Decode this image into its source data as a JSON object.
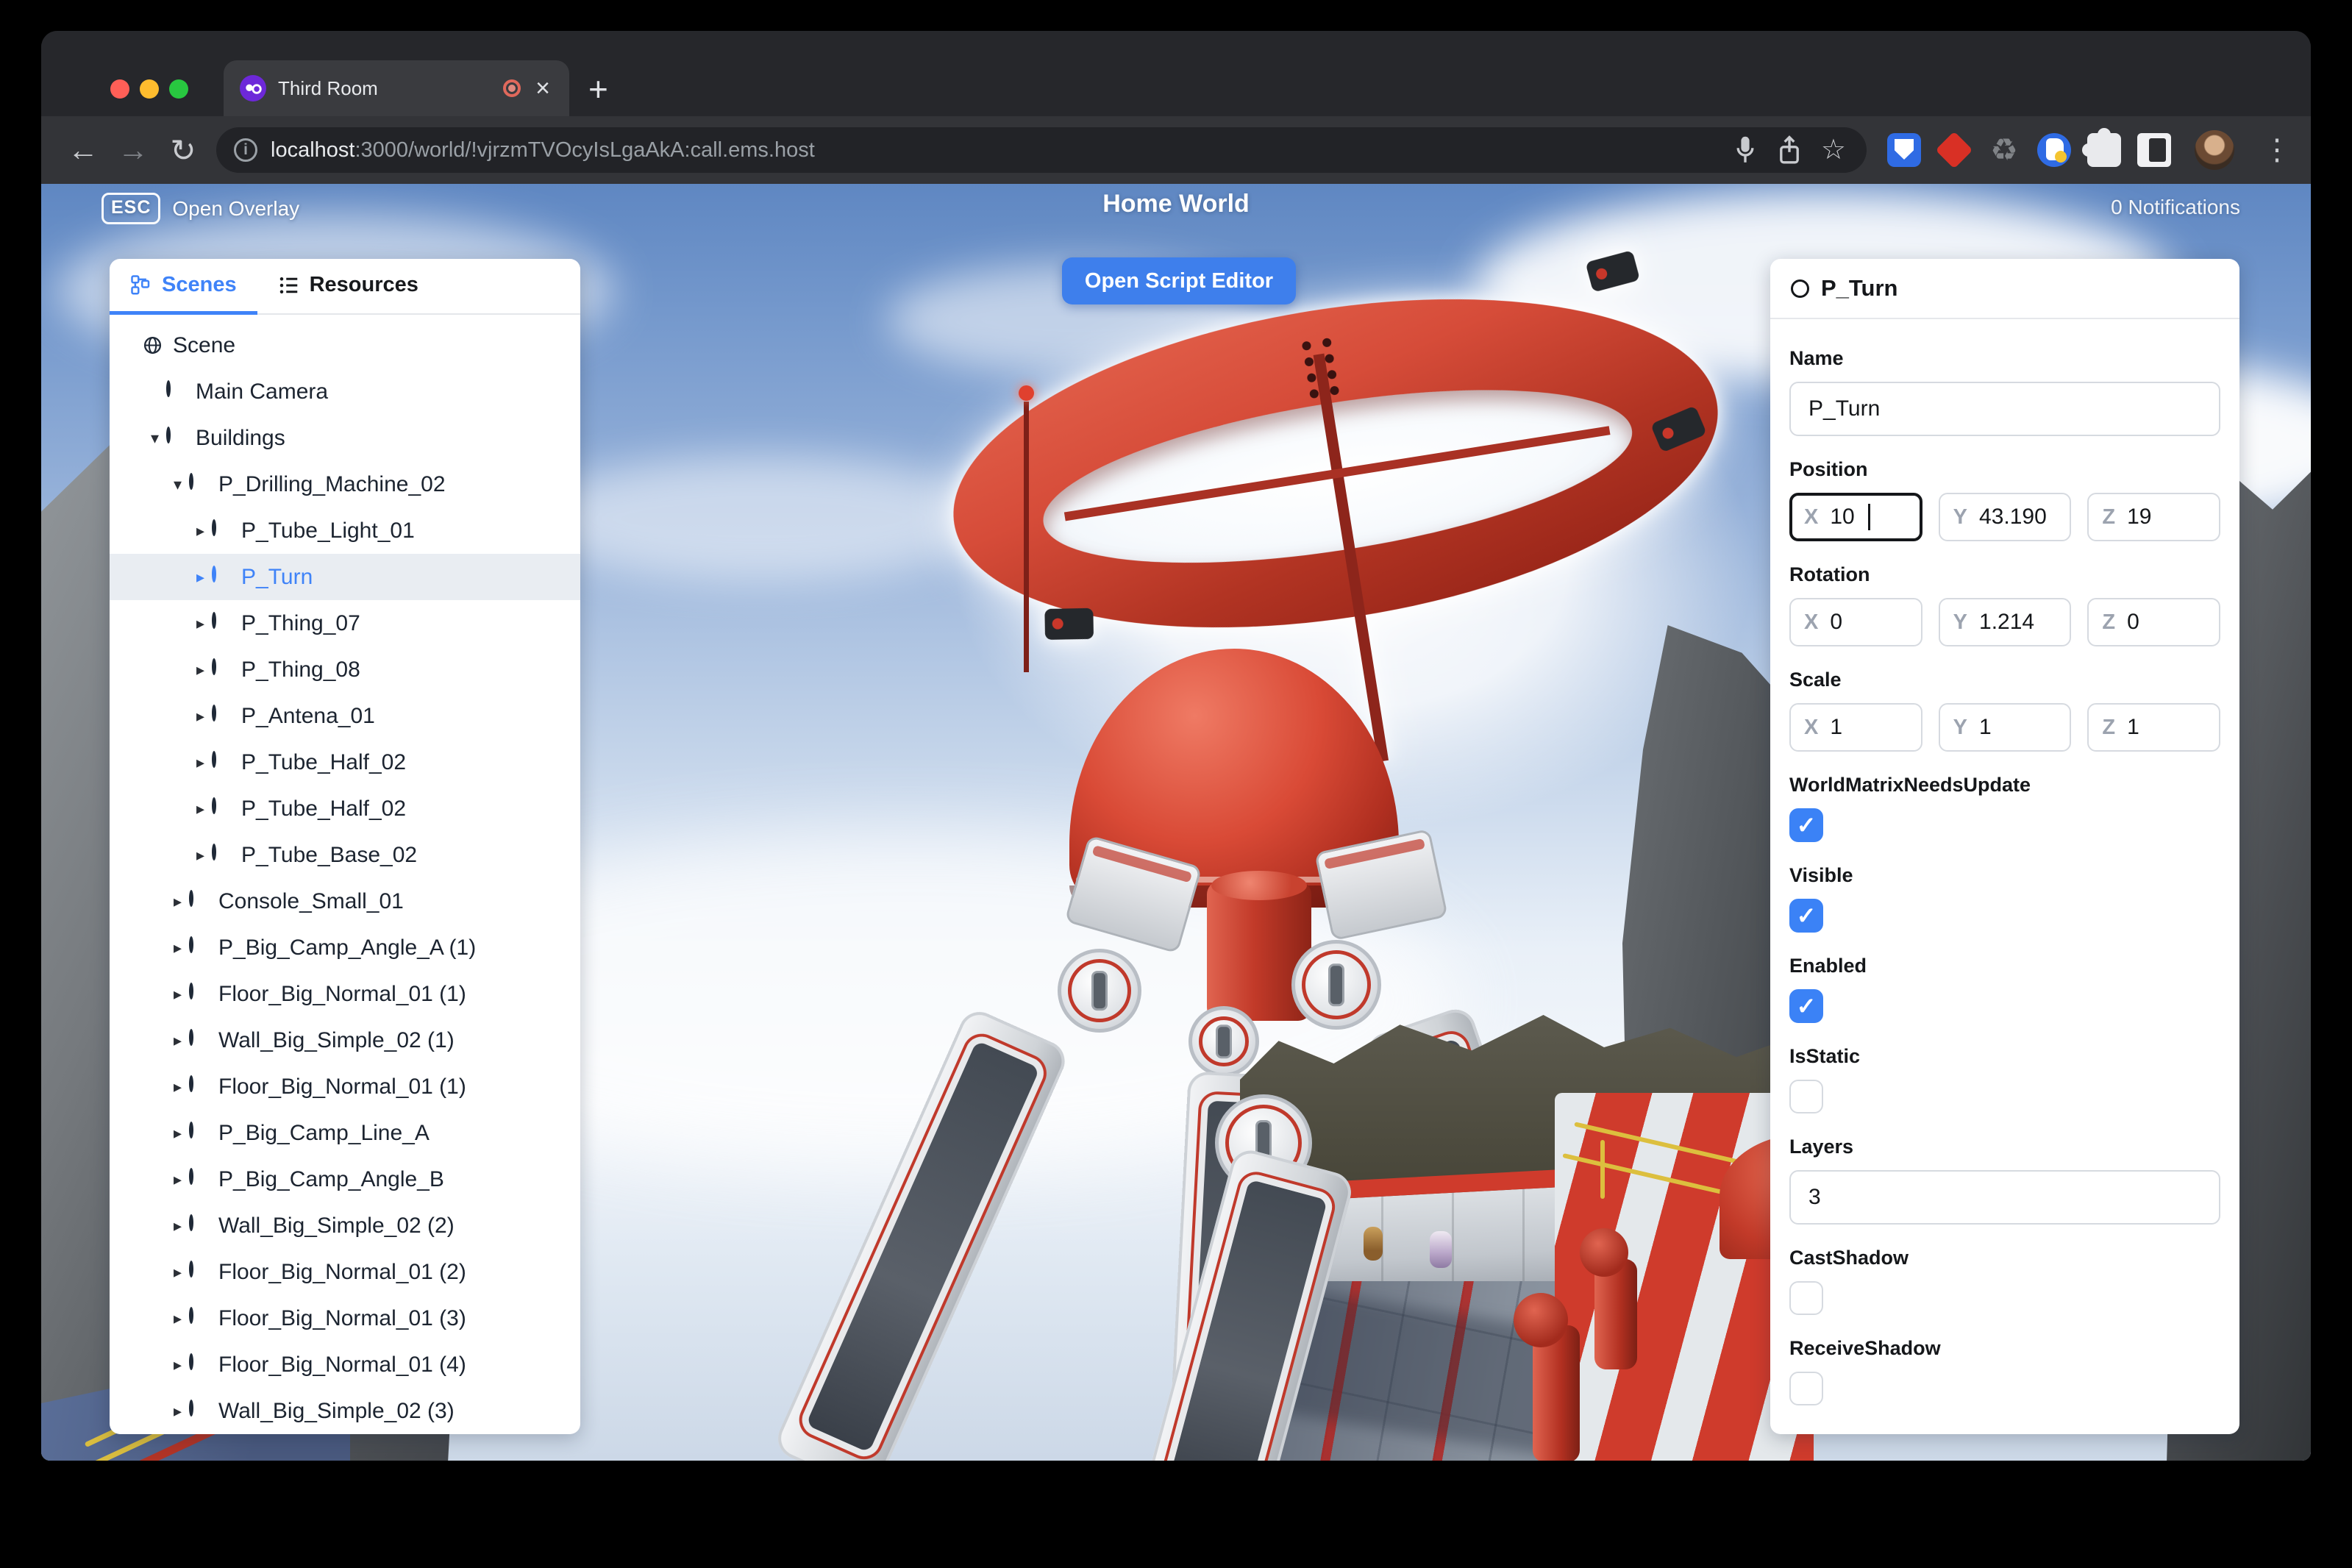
{
  "browser": {
    "tab_title": "Third Room",
    "url_host": "localhost",
    "url_rest": ":3000/world/!vjrzmTVOcyIsLgaAkA:call.ems.host",
    "toolbar_icons": [
      "back-arrow",
      "forward-arrow",
      "reload",
      "page-info",
      "microphone",
      "share",
      "bookmark-star",
      "bitwarden-extension",
      "red-diamond-extension",
      "recycle-extension",
      "moon-extension",
      "extensions-puzzle",
      "frame-extension",
      "profile-avatar",
      "menu-kebab"
    ]
  },
  "glyphs": {
    "back": "←",
    "forward": "→",
    "reload": "↻",
    "info": "i",
    "star": "☆",
    "plus": "+",
    "close": "×",
    "kebab": "⋮",
    "check": "✓",
    "recycle": "♻",
    "arrow_down": "▾",
    "arrow_right": "▸"
  },
  "topbar": {
    "esc_key": "ESC",
    "open_overlay": "Open Overlay",
    "world_title": "Home World",
    "notifications": "0 Notifications"
  },
  "viewport": {
    "open_script_editor": "Open Script Editor",
    "selected_object": "P_Turn",
    "scene_palette": {
      "machine_red": "#c23a29",
      "rock_gray": "#5d6165",
      "sky_blue": "#7498cc"
    }
  },
  "left_panel": {
    "tabs": [
      {
        "label": "Scenes",
        "icon": "hierarchy",
        "active": true
      },
      {
        "label": "Resources",
        "icon": "list",
        "active": false
      }
    ],
    "tree": [
      {
        "depth": 0,
        "arrow": null,
        "icon": "globe",
        "label": "Scene"
      },
      {
        "depth": 1,
        "arrow": null,
        "icon": "node",
        "label": "Main Camera"
      },
      {
        "depth": 1,
        "arrow": "down",
        "icon": "node",
        "label": "Buildings"
      },
      {
        "depth": 2,
        "arrow": "down",
        "icon": "node",
        "label": "P_Drilling_Machine_02"
      },
      {
        "depth": 3,
        "arrow": "right",
        "icon": "node",
        "label": "P_Tube_Light_01"
      },
      {
        "depth": 3,
        "arrow": "right",
        "icon": "node",
        "label": "P_Turn",
        "selected": true
      },
      {
        "depth": 3,
        "arrow": "right",
        "icon": "node",
        "label": "P_Thing_07"
      },
      {
        "depth": 3,
        "arrow": "right",
        "icon": "node",
        "label": "P_Thing_08"
      },
      {
        "depth": 3,
        "arrow": "right",
        "icon": "node",
        "label": "P_Antena_01"
      },
      {
        "depth": 3,
        "arrow": "right",
        "icon": "node",
        "label": "P_Tube_Half_02"
      },
      {
        "depth": 3,
        "arrow": "right",
        "icon": "node",
        "label": "P_Tube_Half_02"
      },
      {
        "depth": 3,
        "arrow": "right",
        "icon": "node",
        "label": "P_Tube_Base_02"
      },
      {
        "depth": 2,
        "arrow": "right",
        "icon": "node",
        "label": "Console_Small_01"
      },
      {
        "depth": 2,
        "arrow": "right",
        "icon": "node",
        "label": "P_Big_Camp_Angle_A (1)"
      },
      {
        "depth": 2,
        "arrow": "right",
        "icon": "node",
        "label": "Floor_Big_Normal_01 (1)"
      },
      {
        "depth": 2,
        "arrow": "right",
        "icon": "node",
        "label": "Wall_Big_Simple_02 (1)"
      },
      {
        "depth": 2,
        "arrow": "right",
        "icon": "node",
        "label": "Floor_Big_Normal_01 (1)"
      },
      {
        "depth": 2,
        "arrow": "right",
        "icon": "node",
        "label": "P_Big_Camp_Line_A"
      },
      {
        "depth": 2,
        "arrow": "right",
        "icon": "node",
        "label": "P_Big_Camp_Angle_B"
      },
      {
        "depth": 2,
        "arrow": "right",
        "icon": "node",
        "label": "Wall_Big_Simple_02 (2)"
      },
      {
        "depth": 2,
        "arrow": "right",
        "icon": "node",
        "label": "Floor_Big_Normal_01 (2)"
      },
      {
        "depth": 2,
        "arrow": "right",
        "icon": "node",
        "label": "Floor_Big_Normal_01 (3)"
      },
      {
        "depth": 2,
        "arrow": "right",
        "icon": "node",
        "label": "Floor_Big_Normal_01 (4)"
      },
      {
        "depth": 2,
        "arrow": "right",
        "icon": "node",
        "label": "Wall_Big_Simple_02 (3)"
      }
    ]
  },
  "inspector": {
    "header": "P_Turn",
    "accent_color": "#3b82f6",
    "sections": [
      {
        "type": "text",
        "label": "Name",
        "value": "P_Turn"
      },
      {
        "type": "vector",
        "label": "Position",
        "axes": [
          "X",
          "Y",
          "Z"
        ],
        "values": [
          "10",
          "43.190",
          "19"
        ],
        "focused": 0
      },
      {
        "type": "vector",
        "label": "Rotation",
        "axes": [
          "X",
          "Y",
          "Z"
        ],
        "values": [
          "0",
          "1.214",
          "0"
        ]
      },
      {
        "type": "vector",
        "label": "Scale",
        "axes": [
          "X",
          "Y",
          "Z"
        ],
        "values": [
          "1",
          "1",
          "1"
        ]
      },
      {
        "type": "checkbox",
        "label": "WorldMatrixNeedsUpdate",
        "checked": true
      },
      {
        "type": "checkbox",
        "label": "Visible",
        "checked": true
      },
      {
        "type": "checkbox",
        "label": "Enabled",
        "checked": true
      },
      {
        "type": "checkbox",
        "label": "IsStatic",
        "checked": false
      },
      {
        "type": "text",
        "label": "Layers",
        "value": "3"
      },
      {
        "type": "checkbox",
        "label": "CastShadow",
        "checked": false
      },
      {
        "type": "checkbox",
        "label": "ReceiveShadow",
        "checked": false
      }
    ]
  }
}
